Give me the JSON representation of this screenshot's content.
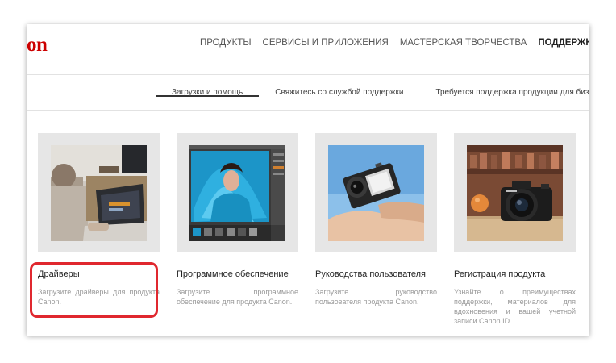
{
  "brand": {
    "logo_text": "on",
    "color": "#cc0000"
  },
  "nav": {
    "items": [
      {
        "label": "ПРОДУКТЫ",
        "active": false
      },
      {
        "label": "СЕРВИСЫ И ПРИЛОЖЕНИЯ",
        "active": false
      },
      {
        "label": "МАСТЕРСКАЯ ТВОРЧЕСТВА",
        "active": false
      },
      {
        "label": "ПОДДЕРЖКА",
        "active": true
      }
    ]
  },
  "subnav": {
    "items": [
      {
        "label": "Загрузки и помощь",
        "active": true
      },
      {
        "label": "Свяжитесь со службой поддержки",
        "active": false
      },
      {
        "label": "Требуется поддержка продукции для бизнеса",
        "active": false
      }
    ]
  },
  "cards": [
    {
      "title": "Драйверы",
      "description": "Загрузите драйверы для продукта Canon.",
      "image_icon": "laptop-photo"
    },
    {
      "title": "Программное обеспечение",
      "description": "Загрузите программное обеспечение для продукта Canon.",
      "image_icon": "photo-editor-photo"
    },
    {
      "title": "Руководства пользователя",
      "description": "Загрузите руководство пользователя продукта Canon.",
      "image_icon": "compact-camera-photo"
    },
    {
      "title": "Регистрация продукта",
      "description": "Узнайте о преимуществах поддержки, материалов для вдохновения и вашей учетной записи Canon ID.",
      "image_icon": "dslr-camera-photo"
    }
  ],
  "annotation": {
    "color": "#e0282f",
    "target": "Драйверы"
  }
}
